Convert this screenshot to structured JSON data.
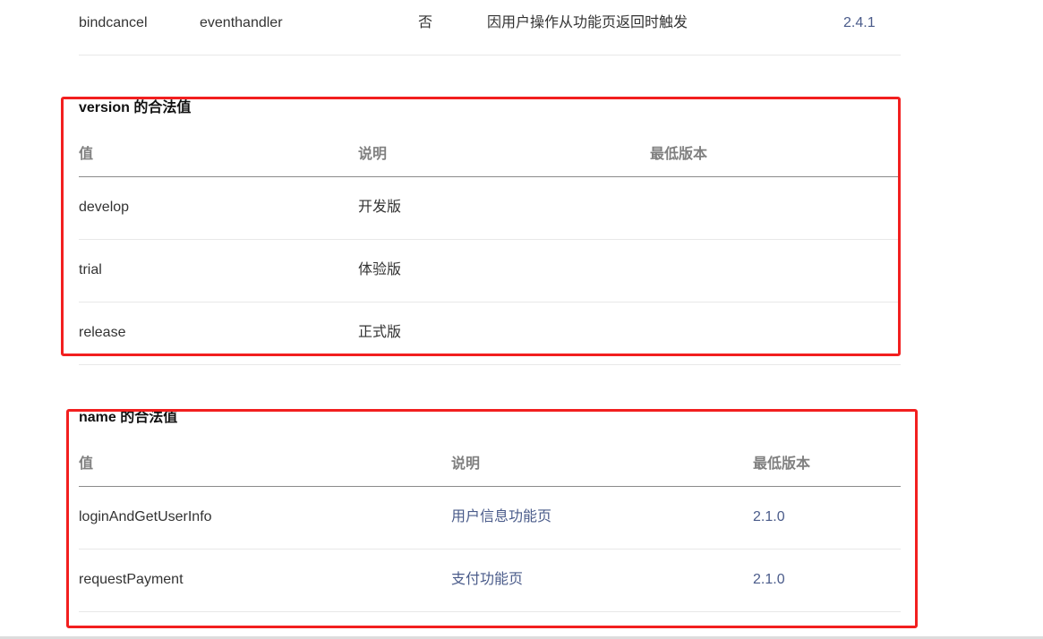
{
  "top_row": {
    "name": "bindcancel",
    "type": "eventhandler",
    "required": "否",
    "description": "因用户操作从功能页返回时触发",
    "version": "2.4.1"
  },
  "version_section": {
    "heading": "version 的合法值",
    "headers": [
      "值",
      "说明",
      "最低版本"
    ],
    "rows": [
      {
        "value": "develop",
        "desc": "开发版",
        "min": ""
      },
      {
        "value": "trial",
        "desc": "体验版",
        "min": ""
      },
      {
        "value": "release",
        "desc": "正式版",
        "min": ""
      }
    ]
  },
  "name_section": {
    "heading": "name 的合法值",
    "headers": [
      "值",
      "说明",
      "最低版本"
    ],
    "rows": [
      {
        "value": "loginAndGetUserInfo",
        "desc": "用户信息功能页",
        "min": "2.1.0"
      },
      {
        "value": "requestPayment",
        "desc": "支付功能页",
        "min": "2.1.0"
      }
    ]
  },
  "colors": {
    "highlight_box": "#f21f1f",
    "link": "#4a5b8a"
  }
}
